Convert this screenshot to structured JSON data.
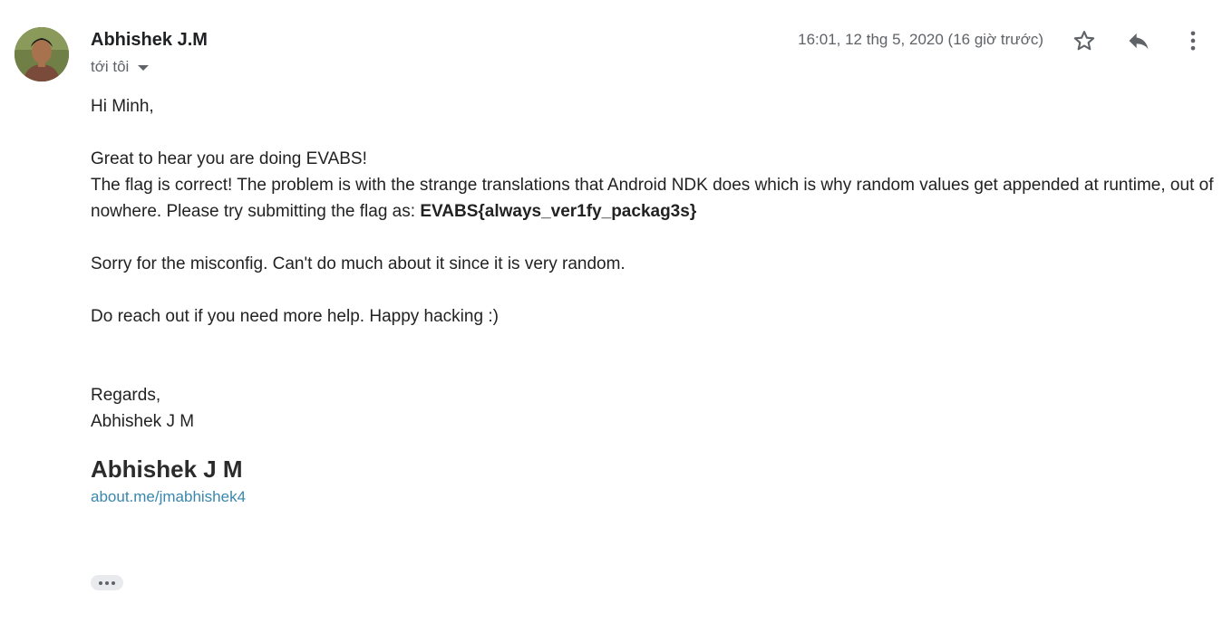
{
  "sender": {
    "name": "Abhishek J.M",
    "recipient_label": "tới tôi"
  },
  "header": {
    "timestamp": "16:01, 12 thg 5, 2020 (16 giờ trước)",
    "icons": [
      "star-icon",
      "reply-icon",
      "more-vert-icon"
    ]
  },
  "body": {
    "greeting": "Hi Minh,",
    "line1": "Great to hear you are doing EVABS!",
    "line2": "The flag is correct! The problem is with the strange translations that Android NDK does which is why random values get appended at runtime, out of nowhere. Please try submitting the flag as: ",
    "flag": "EVABS{always_ver1fy_packag3s}",
    "line3": "Sorry for the misconfig. Can't do much about it since it is very random.",
    "line4": "Do reach out if you need more help. Happy hacking :)",
    "closing": "Regards,",
    "closing_name": "Abhishek J M"
  },
  "signature": {
    "name": "Abhishek J M",
    "link": "about.me/jmabhishek4"
  },
  "colors": {
    "link": "#3a87ad",
    "muted": "#5f6368",
    "text": "#222222"
  }
}
